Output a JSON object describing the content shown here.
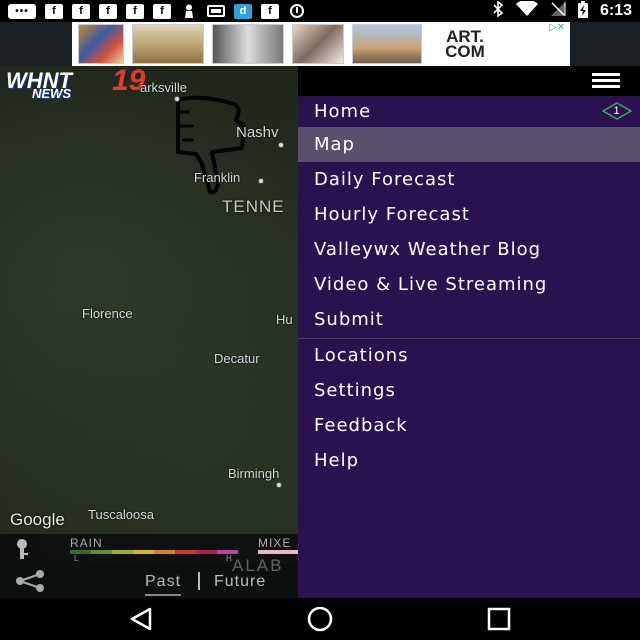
{
  "status_bar": {
    "time": "6:13",
    "left_icons": [
      "chat-dots-icon",
      "facebook-icon",
      "facebook-icon",
      "facebook-icon",
      "facebook-icon",
      "facebook-icon",
      "pawn-icon",
      "cast-icon",
      "d-app-icon",
      "facebook-icon",
      "sync-icon"
    ],
    "right_icons": [
      "bluetooth-icon",
      "wifi-icon",
      "signal-icon",
      "battery-charging-icon"
    ],
    "dots_label": "•••",
    "d_label": "d",
    "fb_label": "f"
  },
  "ad": {
    "logo_text_top": "ART.",
    "logo_text_bottom": "COM",
    "adchoices": "▷✕"
  },
  "app": {
    "logo_whnt": "WHNT",
    "logo_number": "19",
    "logo_news": "NEWS"
  },
  "map": {
    "labels": {
      "clarksville": "arksville",
      "nashville": "Nashv",
      "franklin": "Franklin",
      "tennessee": "TENNE",
      "florence": "Florence",
      "huntsville": "Hu",
      "decatur": "Decatur",
      "birmingham": "Birmingh",
      "tuscaloosa": "Tuscaloosa",
      "alabama": "ALAB"
    },
    "google_label": "Google",
    "legend": {
      "rain_label": "RAIN",
      "mixed_label": "MIXE",
      "low_label": "L",
      "high_label": "H",
      "rain_colors": [
        "#3a6b2c",
        "#5c8f2f",
        "#9bb12c",
        "#d6b42a",
        "#d98326",
        "#c9382a",
        "#b0234a",
        "#c23fa3"
      ]
    },
    "time_tabs": {
      "past": "Past",
      "future": "Future"
    }
  },
  "drawer": {
    "menu": [
      {
        "label": "Home",
        "badge": "1"
      },
      {
        "label": "Map",
        "active": true
      },
      {
        "label": "Daily Forecast"
      },
      {
        "label": "Hourly Forecast"
      },
      {
        "label": "Valleywx Weather Blog"
      },
      {
        "label": "Video & Live Streaming"
      },
      {
        "label": "Submit"
      },
      {
        "label": "Locations"
      },
      {
        "label": "Settings"
      },
      {
        "label": "Feedback"
      },
      {
        "label": "Help"
      }
    ]
  },
  "colors": {
    "drawer_bg": "#2a1150",
    "active_item_bg": "#5a4f6d",
    "badge_border": "#3fa56a",
    "brand_red": "#e23c2f"
  }
}
